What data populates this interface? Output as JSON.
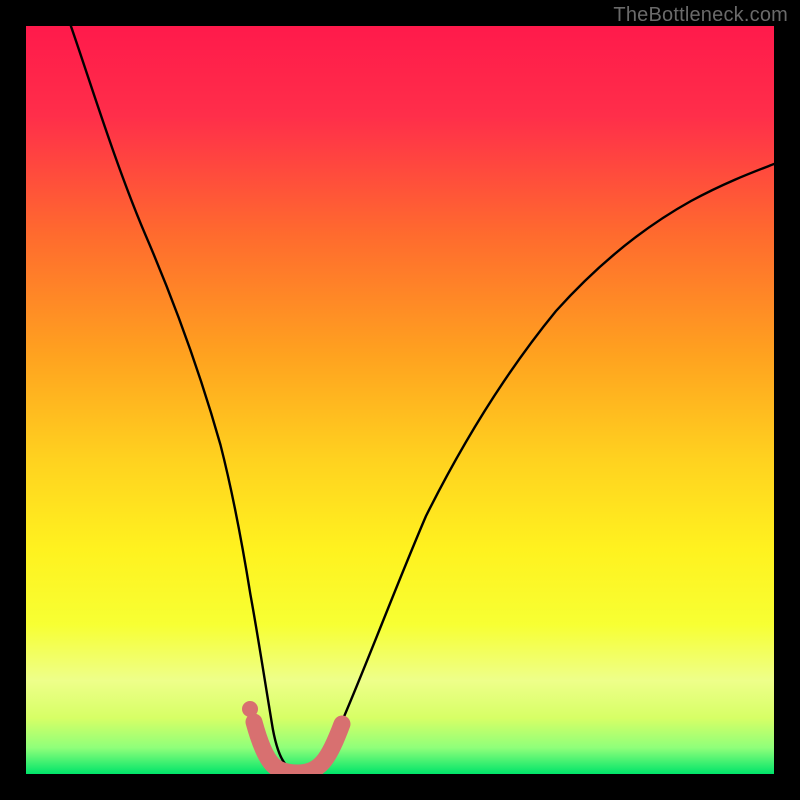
{
  "watermark": "TheBottleneck.com",
  "colors": {
    "bg_black": "#000000",
    "grad_top": "#ff1a4b",
    "grad_mid_upper": "#ff6b2e",
    "grad_mid": "#ffd21f",
    "grad_mid_lower": "#f7ff33",
    "grad_lower": "#d7ff66",
    "grad_bottom": "#00e46a",
    "curve": "#000000",
    "marker_fill": "#d87070",
    "marker_stroke": "#b84f4f"
  },
  "chart_data": {
    "type": "line",
    "title": "",
    "xlabel": "",
    "ylabel": "",
    "xlim": [
      0,
      100
    ],
    "ylim": [
      0,
      100
    ],
    "series": [
      {
        "name": "bottleneck-curve",
        "x": [
          6,
          8,
          10,
          12,
          14,
          16,
          18,
          20,
          22,
          24,
          26,
          27,
          28,
          29,
          30,
          31,
          32,
          33,
          34,
          35,
          36,
          37,
          38,
          40,
          42,
          45,
          48,
          52,
          56,
          60,
          65,
          70,
          75,
          80,
          85,
          90,
          95,
          100
        ],
        "y": [
          100,
          93,
          86,
          79,
          72,
          65,
          58,
          51,
          44,
          37,
          30,
          26,
          22,
          18,
          14,
          10,
          6,
          3,
          1,
          0,
          0,
          0,
          1,
          4,
          8,
          14,
          20,
          27,
          33,
          39,
          46,
          52,
          57,
          62,
          66,
          70,
          73,
          76
        ]
      }
    ],
    "markers": {
      "name": "highlighted-segment",
      "x_range": [
        30,
        40
      ],
      "y_approx": 0,
      "comment": "U-shaped thick marker strip around the curve minimum"
    },
    "extra_marker_dot": {
      "x": 30.5,
      "y": 4
    },
    "optimum_x": 35
  }
}
